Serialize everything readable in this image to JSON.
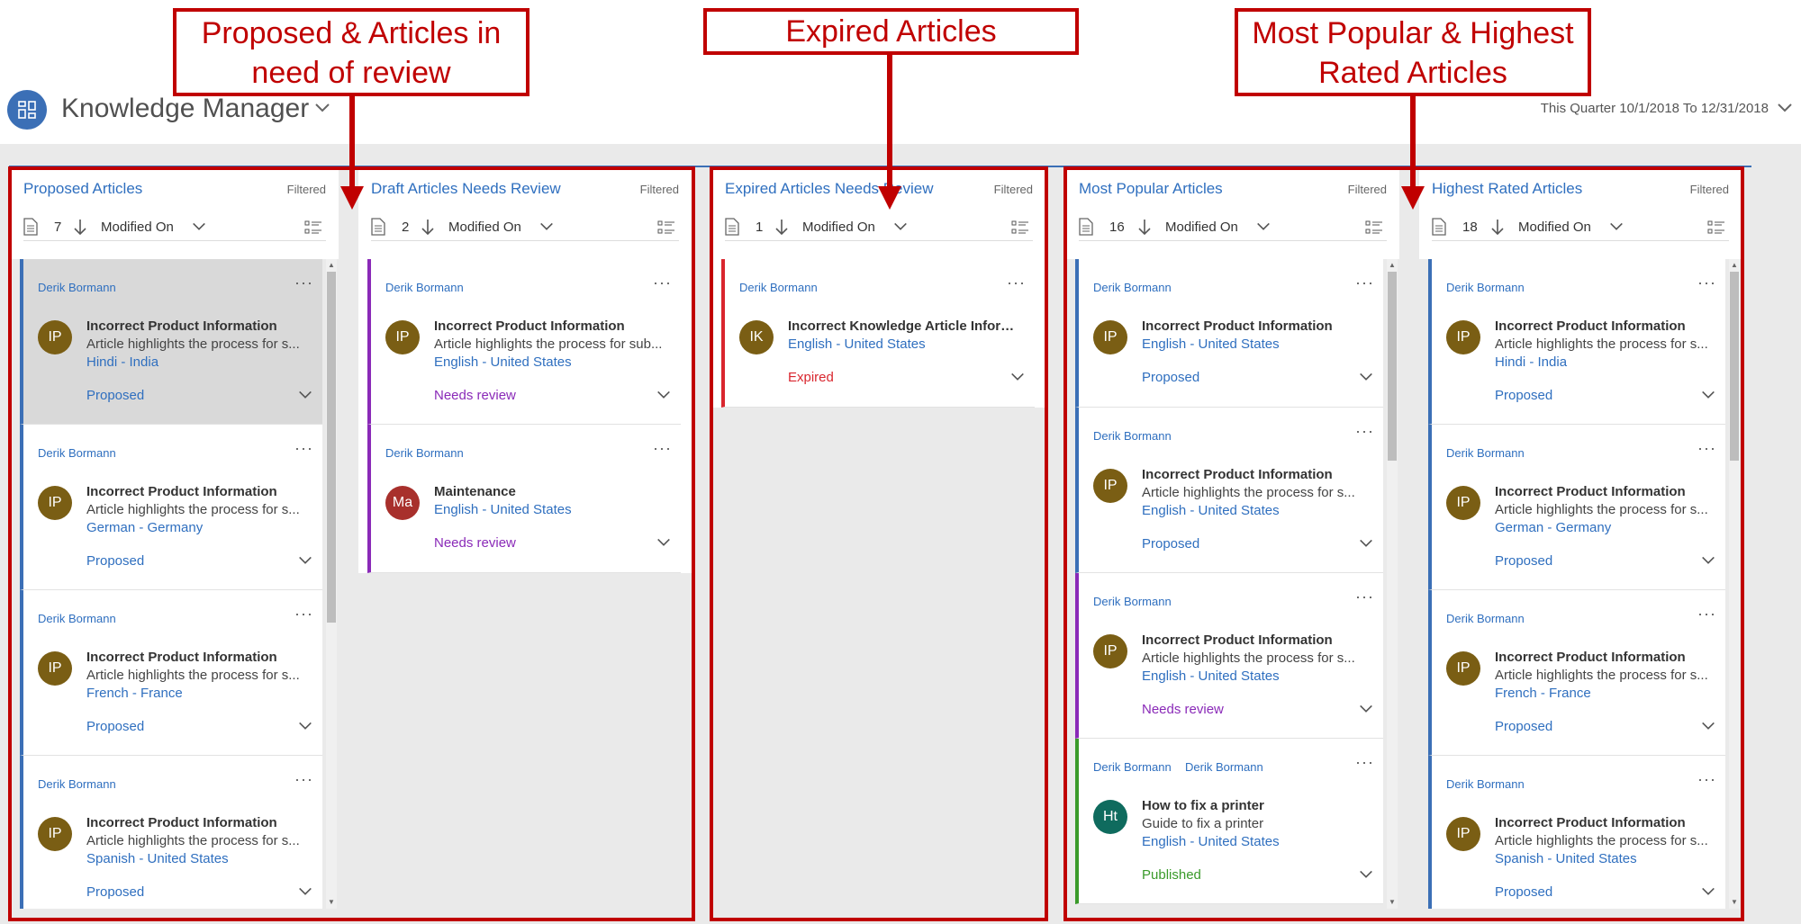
{
  "header": {
    "app_title": "Knowledge Manager",
    "date_range": "This Quarter 10/1/2018 To 12/31/2018"
  },
  "annotations": [
    {
      "text": "Proposed & Articles in need of review"
    },
    {
      "text": "Expired Articles"
    },
    {
      "text": "Most Popular & Highest Rated Articles"
    }
  ],
  "colors": {
    "accent": "#2f6fbf",
    "annotation_red": "#c00000",
    "proposed": "#3b6fb6",
    "needs_review": "#8a2ab8",
    "expired": "#d9262e",
    "published": "#3a9a2a"
  },
  "columns": [
    {
      "title": "Proposed Articles",
      "filter": "Filtered",
      "count": "7",
      "sort": "Modified On",
      "cards": [
        {
          "owner": "Derik Bormann",
          "avatar": "IP",
          "title": "Incorrect Product Information",
          "desc": "Article highlights the process for s...",
          "lang": "Hindi - India",
          "status": "Proposed"
        },
        {
          "owner": "Derik Bormann",
          "avatar": "IP",
          "title": "Incorrect Product Information",
          "desc": "Article highlights the process for s...",
          "lang": "German - Germany",
          "status": "Proposed"
        },
        {
          "owner": "Derik Bormann",
          "avatar": "IP",
          "title": "Incorrect Product Information",
          "desc": "Article highlights the process for s...",
          "lang": "French - France",
          "status": "Proposed"
        },
        {
          "owner": "Derik Bormann",
          "avatar": "IP",
          "title": "Incorrect Product Information",
          "desc": "Article highlights the process for s...",
          "lang": "Spanish - United States",
          "status": "Proposed"
        }
      ]
    },
    {
      "title": "Draft Articles Needs Review",
      "filter": "Filtered",
      "count": "2",
      "sort": "Modified On",
      "cards": [
        {
          "owner": "Derik Bormann",
          "avatar": "IP",
          "title": "Incorrect Product Information",
          "desc": "Article highlights the process for sub...",
          "lang": "English - United States",
          "status": "Needs review"
        },
        {
          "owner": "Derik Bormann",
          "avatar": "Ma",
          "title": "Maintenance",
          "lang": "English - United States",
          "status": "Needs review"
        }
      ]
    },
    {
      "title": "Expired Articles Needs Review",
      "filter": "Filtered",
      "count": "1",
      "sort": "Modified On",
      "cards": [
        {
          "owner": "Derik Bormann",
          "avatar": "IK",
          "title": "Incorrect Knowledge Article Informa...",
          "lang": "English - United States",
          "status": "Expired"
        }
      ]
    },
    {
      "title": "Most Popular Articles",
      "filter": "Filtered",
      "count": "16",
      "sort": "Modified On",
      "cards": [
        {
          "owner": "Derik Bormann",
          "avatar": "IP",
          "title": "Incorrect Product Information",
          "lang": "English - United States",
          "status": "Proposed"
        },
        {
          "owner": "Derik Bormann",
          "avatar": "IP",
          "title": "Incorrect Product Information",
          "desc": "Article highlights the process for s...",
          "lang": "English - United States",
          "status": "Proposed"
        },
        {
          "owner": "Derik Bormann",
          "avatar": "IP",
          "title": "Incorrect Product Information",
          "desc": "Article highlights the process for s...",
          "lang": "English - United States",
          "status": "Needs review"
        },
        {
          "owner": "Derik Bormann",
          "owner2": "Derik Bormann",
          "avatar": "Ht",
          "title": "How to fix a printer",
          "desc": "Guide to fix a printer",
          "lang": "English - United States",
          "status": "Published"
        }
      ]
    },
    {
      "title": "Highest Rated Articles",
      "filter": "Filtered",
      "count": "18",
      "sort": "Modified On",
      "cards": [
        {
          "owner": "Derik Bormann",
          "avatar": "IP",
          "title": "Incorrect Product Information",
          "desc": "Article highlights the process for s...",
          "lang": "Hindi - India",
          "status": "Proposed"
        },
        {
          "owner": "Derik Bormann",
          "avatar": "IP",
          "title": "Incorrect Product Information",
          "desc": "Article highlights the process for s...",
          "lang": "German - Germany",
          "status": "Proposed"
        },
        {
          "owner": "Derik Bormann",
          "avatar": "IP",
          "title": "Incorrect Product Information",
          "desc": "Article highlights the process for s...",
          "lang": "French - France",
          "status": "Proposed"
        },
        {
          "owner": "Derik Bormann",
          "avatar": "IP",
          "title": "Incorrect Product Information",
          "desc": "Article highlights the process for s...",
          "lang": "Spanish - United States",
          "status": "Proposed"
        }
      ]
    }
  ]
}
